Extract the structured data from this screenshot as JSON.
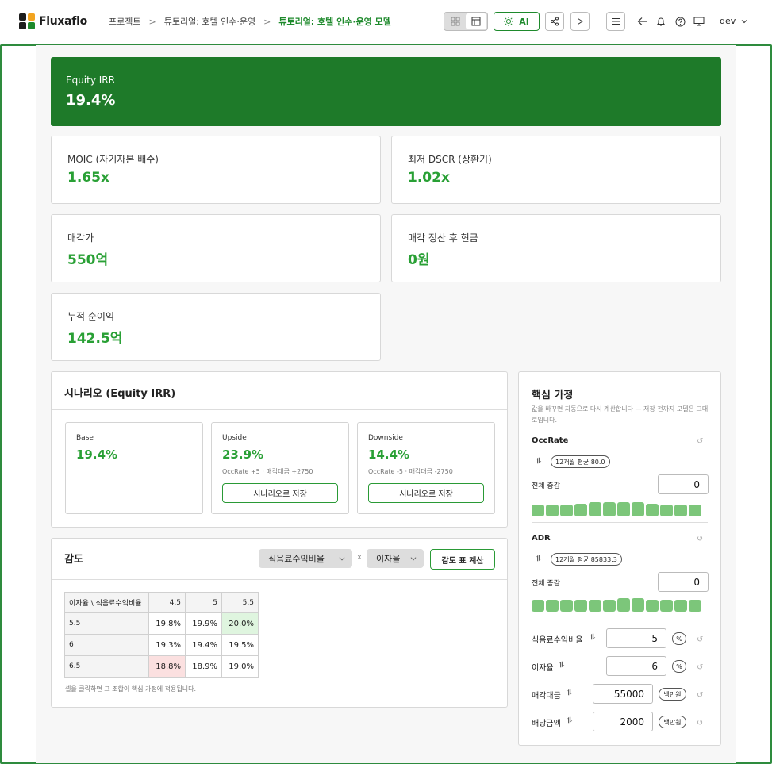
{
  "app": {
    "name": "Fluxaflo",
    "user": "dev"
  },
  "breadcrumb": {
    "items": [
      "프로젝트",
      "튜토리얼: 호텔 인수·운영"
    ],
    "current": "튜토리얼: 호텔 인수·운영 모델",
    "separator": ">"
  },
  "toolbar": {
    "ai_label": "AI"
  },
  "hero": {
    "label": "Equity IRR",
    "value": "19.4%"
  },
  "kpis": [
    {
      "label": "MOIC (자기자본 배수)",
      "value": "1.65x"
    },
    {
      "label": "최저 DSCR (상환기)",
      "value": "1.02x"
    },
    {
      "label": "매각가",
      "value": "550억"
    },
    {
      "label": "매각 정산 후 현금",
      "value": "0원"
    },
    {
      "label": "누적 순이익",
      "value": "142.5억"
    }
  ],
  "scenarios": {
    "title": "시나리오 (Equity IRR)",
    "save_label": "시나리오로 저장",
    "items": [
      {
        "name": "Base",
        "value": "19.4%",
        "desc": ""
      },
      {
        "name": "Upside",
        "value": "23.9%",
        "desc": "OccRate +5 · 매각대금 +2750"
      },
      {
        "name": "Downside",
        "value": "14.4%",
        "desc": "OccRate -5 · 매각대금 -2750"
      }
    ]
  },
  "sensitivity": {
    "title": "감도",
    "x_select": "식음료수익비율",
    "times": "x",
    "y_select": "이자율",
    "compute_label": "감도 표 계산",
    "corner": "이자율 \\ 식음료수익비율",
    "cols": [
      "4.5",
      "5",
      "5.5"
    ],
    "rows": [
      {
        "h": "5.5",
        "c": [
          "19.8%",
          "19.9%",
          "20.0%"
        ]
      },
      {
        "h": "6",
        "c": [
          "19.3%",
          "19.4%",
          "19.5%"
        ]
      },
      {
        "h": "6.5",
        "c": [
          "18.8%",
          "18.9%",
          "19.0%"
        ]
      }
    ],
    "hint": "셀을 클릭하면 그 조합이 핵심 가정에 적용됩니다.",
    "high_color": "#dff5df",
    "low_color": "#fbe0e0"
  },
  "assumptions": {
    "title": "핵심 가정",
    "note": "값을 바꾸면 자동으로 다시 계산합니다 — 저장 전까지 모델은 그대로입니다.",
    "occ": {
      "name": "OccRate",
      "avg": "12개월 평균 80.0",
      "total_label": "전체 증감",
      "total": "0"
    },
    "adr": {
      "name": "ADR",
      "avg": "12개월 평균 85833.3",
      "total_label": "전체 증감",
      "total": "0"
    },
    "params": [
      {
        "label": "식음료수익비율",
        "value": "5",
        "unit": "%"
      },
      {
        "label": "이자율",
        "value": "6",
        "unit": "%"
      },
      {
        "label": "매각대금",
        "value": "55000",
        "unit": "백만원"
      },
      {
        "label": "배당금액",
        "value": "2000",
        "unit": "백만원"
      }
    ]
  },
  "colors": {
    "brand": "#1e7a29",
    "accent": "#29a035",
    "bar": "#7cc67a"
  }
}
